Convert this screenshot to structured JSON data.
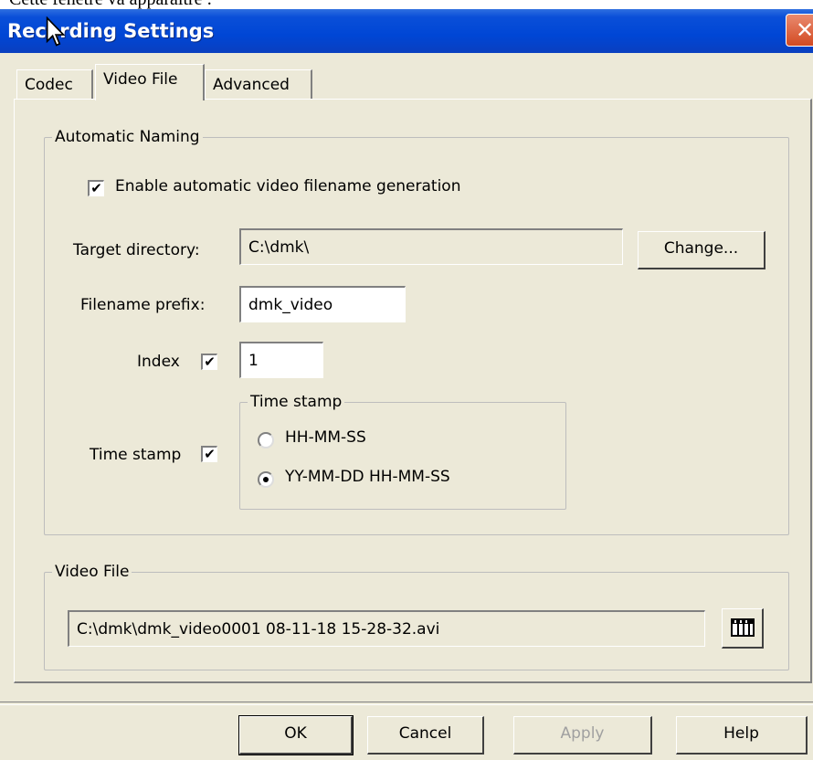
{
  "page_text": "Cette fenêtre va apparaître :",
  "window": {
    "title": "Recording Settings",
    "close_glyph": "✕"
  },
  "tabs": [
    {
      "label": "Codec"
    },
    {
      "label": "Video File"
    },
    {
      "label": "Advanced"
    }
  ],
  "automatic_naming": {
    "group_label": "Automatic Naming",
    "enable_checkbox": {
      "label": "Enable automatic video filename generation",
      "checked": true,
      "mark": "✔"
    },
    "target_directory": {
      "label": "Target directory:",
      "value": "C:\\dmk\\"
    },
    "change_button": "Change...",
    "filename_prefix": {
      "label": "Filename prefix:",
      "value": "dmk_video"
    },
    "index": {
      "label": "Index",
      "checked": true,
      "mark": "✔",
      "value": "1"
    },
    "time_stamp": {
      "label": "Time stamp",
      "checked": true,
      "mark": "✔"
    },
    "time_stamp_group": {
      "label": "Time stamp",
      "options": [
        {
          "label": "HH-MM-SS",
          "selected": false
        },
        {
          "label": "YY-MM-DD HH-MM-SS",
          "selected": true
        }
      ]
    }
  },
  "video_file": {
    "group_label": "Video File",
    "path": "C:\\dmk\\dmk_video0001 08-11-18 15-28-32.avi",
    "browse_icon": "film-strip-icon"
  },
  "buttons": {
    "ok": "OK",
    "cancel": "Cancel",
    "apply": "Apply",
    "help": "Help"
  },
  "colors": {
    "titlebar": "#0046d5",
    "dialog_bg": "#ece9d8",
    "close_btn": "#d34a22"
  }
}
